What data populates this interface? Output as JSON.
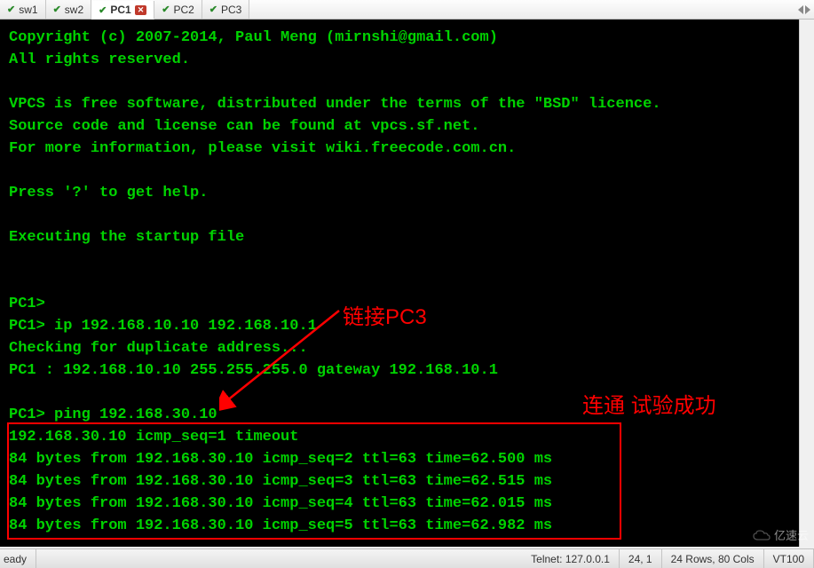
{
  "tabs": [
    {
      "label": "sw1",
      "active": false
    },
    {
      "label": "sw2",
      "active": false
    },
    {
      "label": "PC1",
      "active": true
    },
    {
      "label": "PC2",
      "active": false
    },
    {
      "label": "PC3",
      "active": false
    }
  ],
  "terminal": {
    "lines": [
      "Copyright (c) 2007-2014, Paul Meng (mirnshi@gmail.com)",
      "All rights reserved.",
      "",
      "VPCS is free software, distributed under the terms of the \"BSD\" licence.",
      "Source code and license can be found at vpcs.sf.net.",
      "For more information, please visit wiki.freecode.com.cn.",
      "",
      "Press '?' to get help.",
      "",
      "Executing the startup file",
      "",
      "",
      "PC1>",
      "PC1> ip 192.168.10.10 192.168.10.1",
      "Checking for duplicate address...",
      "PC1 : 192.168.10.10 255.255.255.0 gateway 192.168.10.1",
      "",
      "PC1> ping 192.168.30.10",
      "192.168.30.10 icmp_seq=1 timeout",
      "84 bytes from 192.168.30.10 icmp_seq=2 ttl=63 time=62.500 ms",
      "84 bytes from 192.168.30.10 icmp_seq=3 ttl=63 time=62.515 ms",
      "84 bytes from 192.168.30.10 icmp_seq=4 ttl=63 time=62.015 ms",
      "84 bytes from 192.168.30.10 icmp_seq=5 ttl=63 time=62.982 ms"
    ]
  },
  "annotations": {
    "text1": "链接PC3",
    "text2": "连通 试验成功"
  },
  "statusbar": {
    "ready": "eady",
    "conn": "Telnet: 127.0.0.1",
    "pos": "24, 1",
    "size": "24 Rows, 80 Cols",
    "term": "VT100"
  },
  "watermark": "亿速云"
}
